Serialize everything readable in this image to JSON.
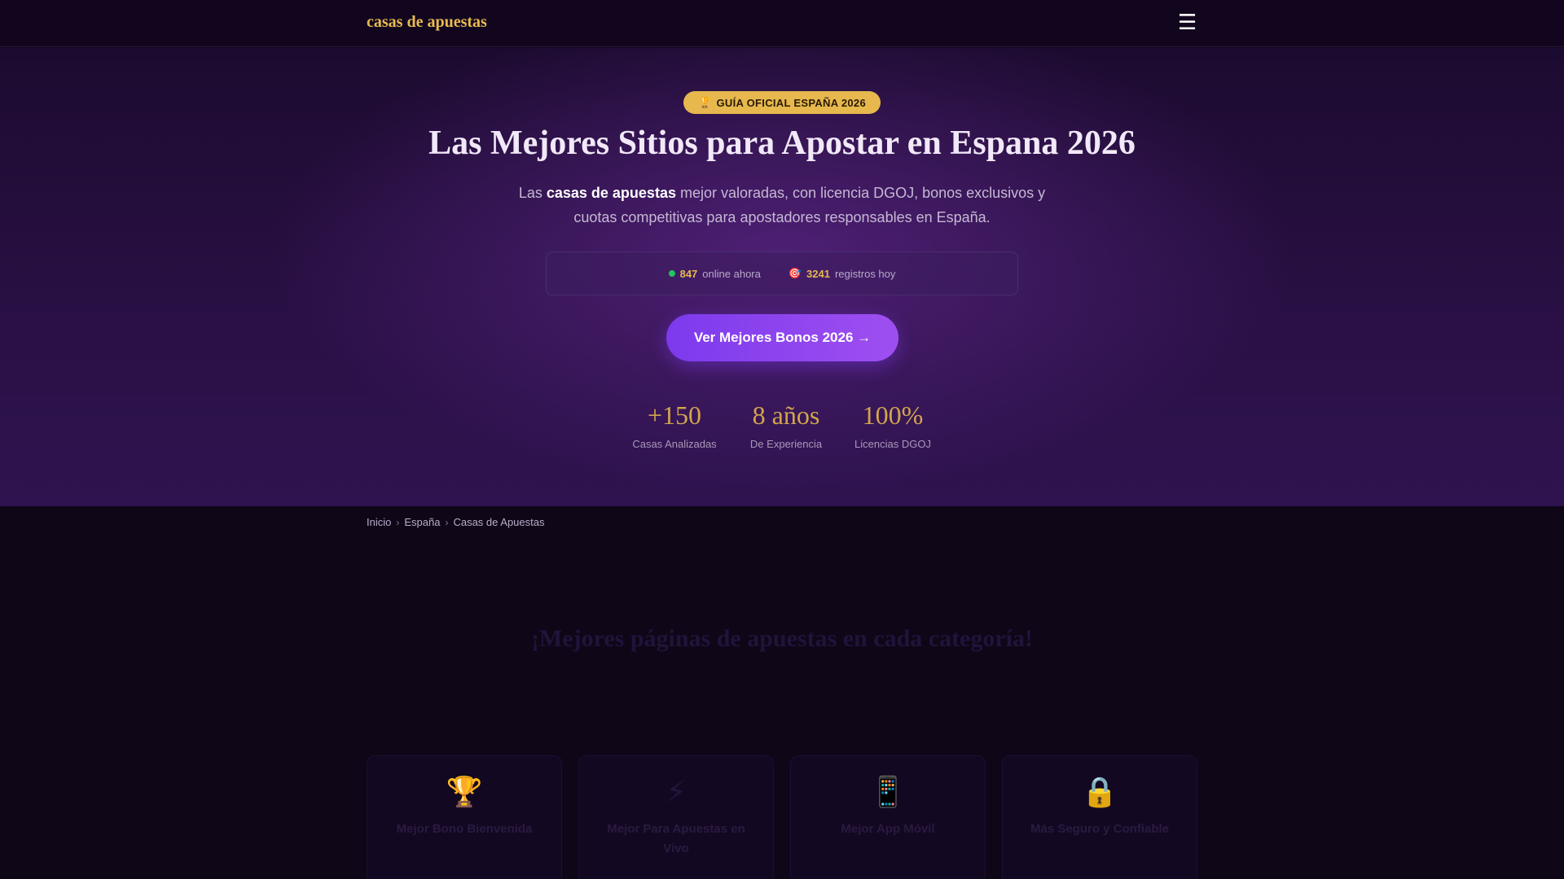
{
  "header": {
    "brand": "casas de apuestas",
    "menu_icon": "hamburger-menu-icon"
  },
  "hero": {
    "badge_icon": "trophy-icon",
    "badge_text": "GUÍA OFICIAL ESPAÑA 2026",
    "title": "Las Mejores Sitios para Apostar en Espana 2026",
    "desc_before": "Las ",
    "desc_bold": "casas de apuestas",
    "desc_after": " mejor valoradas, con licencia DGOJ, bonos exclusivos y cuotas competitivas para apostadores responsables en España.",
    "live": {
      "online_count": "847",
      "online_label": "online ahora",
      "online_color": "#22c55e",
      "registrations_icon": "target-icon",
      "registrations_count": "3241",
      "registrations_label": "registros hoy"
    },
    "cta_label": "Ver Mejores Bonos 2026 →",
    "stats": [
      {
        "value": "+150",
        "label": "Casas Analizadas"
      },
      {
        "value": "8 años",
        "label": "De Experiencia"
      },
      {
        "value": "100%",
        "label": "Licencias DGOJ"
      }
    ]
  },
  "breadcrumb": {
    "items": [
      "Inicio",
      "España",
      "Casas de Apuestas"
    ],
    "separator": "›"
  },
  "section": {
    "title": "¡Mejores páginas de apuestas en cada categoría!",
    "cards": [
      {
        "icon": "trophy-icon",
        "title": "Mejor Bono Bienvenida"
      },
      {
        "icon": "lightning-icon",
        "title": "Mejor Para Apuestas en Vivo"
      },
      {
        "icon": "mobile-phone-icon",
        "title": "Mejor App Móvil"
      },
      {
        "icon": "lock-icon",
        "title": "Más Seguro y Confiable"
      }
    ]
  },
  "colors": {
    "accent_gold": "#e6b84e",
    "cta_purple": "#7c3aed",
    "background": "#0f0618"
  }
}
